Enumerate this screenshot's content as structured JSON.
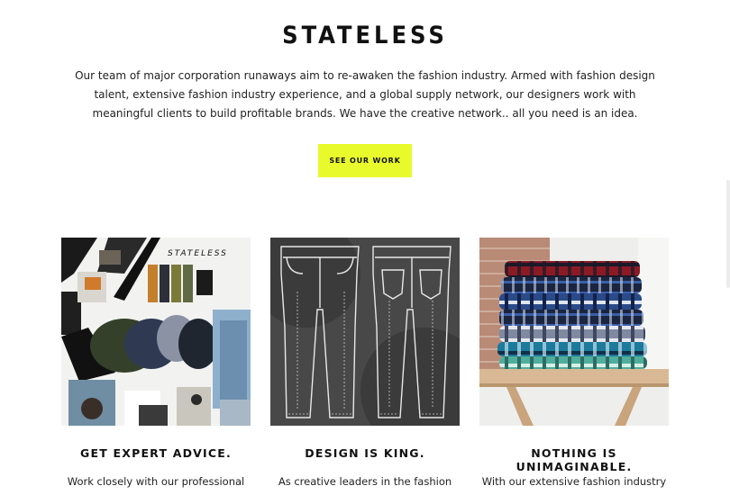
{
  "hero": {
    "title": "STATELESS",
    "description": "Our team of major corporation runaways aim to re-awaken the fashion industry. Armed with fashion design talent, extensive fashion industry experience, and a global supply network, our designers work with meaningful clients to build profitable brands. We have the creative network.. all you need is an idea.",
    "cta_label": "SEE OUR WORK",
    "cta_color": "#e9fa2c"
  },
  "features": [
    {
      "image_label": "STATELESS",
      "image_subject": "moodboard-with-folded-clothes",
      "title": "GET EXPERT ADVICE.",
      "text": "Work closely with our professional"
    },
    {
      "image_subject": "jeans-technical-sketch",
      "title": "DESIGN IS KING.",
      "text": "As creative leaders in the fashion"
    },
    {
      "image_subject": "stack-of-flannel-shirts",
      "title": "NOTHING IS UNIMAGINABLE.",
      "text": "With our extensive fashion industry"
    }
  ]
}
